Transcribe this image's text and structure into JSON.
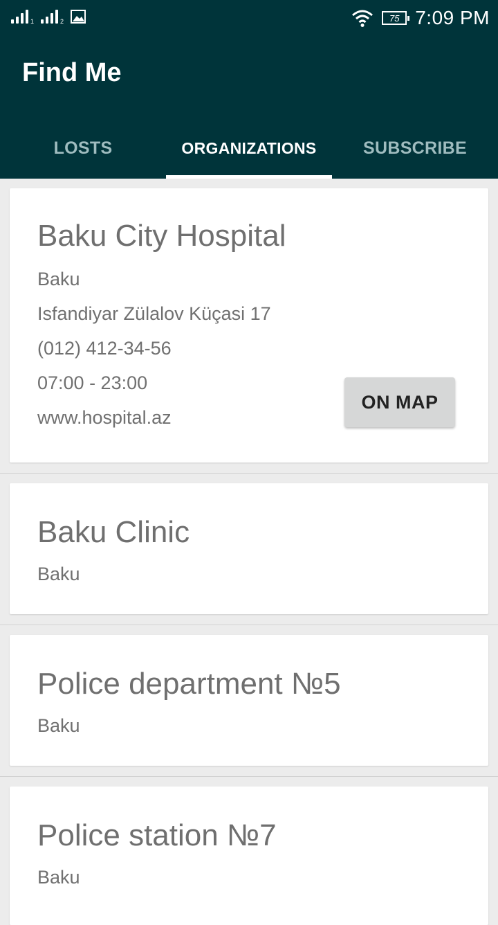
{
  "status_bar": {
    "sim1_label": "1",
    "sim2_label": "2",
    "battery_level": "75",
    "time": "7:09 PM"
  },
  "app": {
    "title": "Find Me"
  },
  "tabs": [
    {
      "label": "LOSTS",
      "active": false
    },
    {
      "label": "ORGANIZATIONS",
      "active": true
    },
    {
      "label": "SUBSCRIBE",
      "active": false
    }
  ],
  "organizations": [
    {
      "name": "Baku City Hospital",
      "city": "Baku",
      "address": "Isfandiyar Zülalov Küçasi 17",
      "phone": "(012) 412-34-56",
      "hours": "07:00 - 23:00",
      "website": "www.hospital.az",
      "map_button_label": "ON MAP"
    },
    {
      "name": "Baku Clinic",
      "city": "Baku"
    },
    {
      "name": "Police department №5",
      "city": "Baku"
    },
    {
      "name": "Police station №7",
      "city": "Baku"
    }
  ],
  "colors": {
    "app_bar": "#00343a",
    "background": "#ececec",
    "card": "#ffffff",
    "tab_inactive": "#9fbcbf",
    "button": "#d6d7d7"
  }
}
